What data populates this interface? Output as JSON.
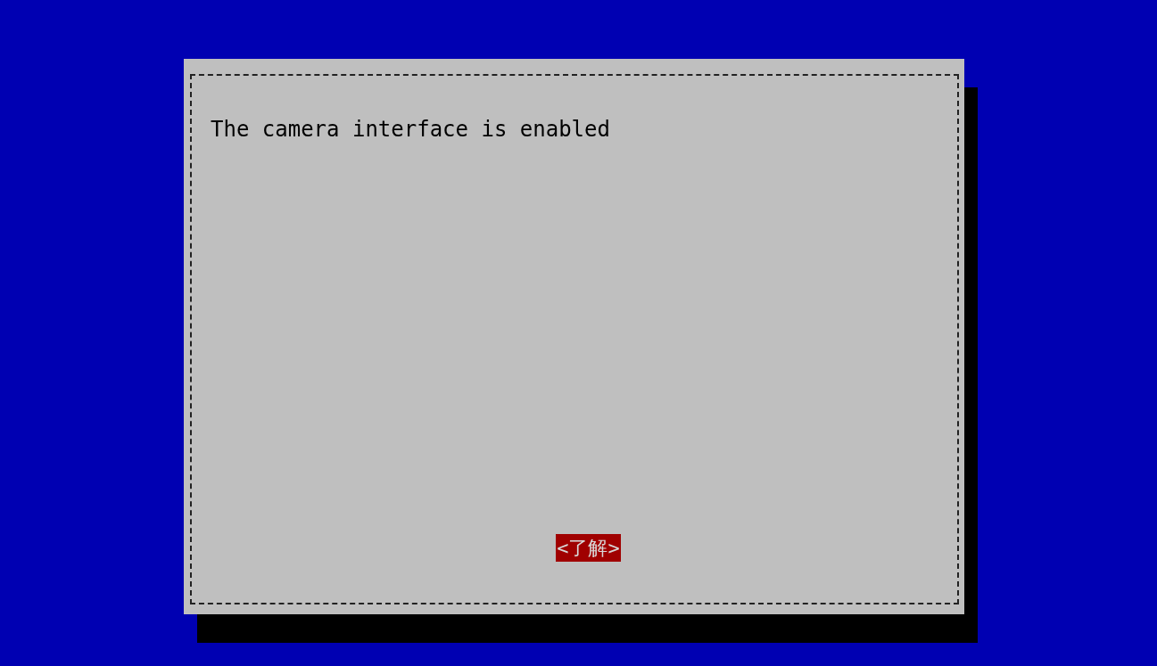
{
  "dialog": {
    "message": "The camera interface is enabled",
    "buttons": [
      {
        "label": "<了解>",
        "selected": true
      }
    ]
  }
}
